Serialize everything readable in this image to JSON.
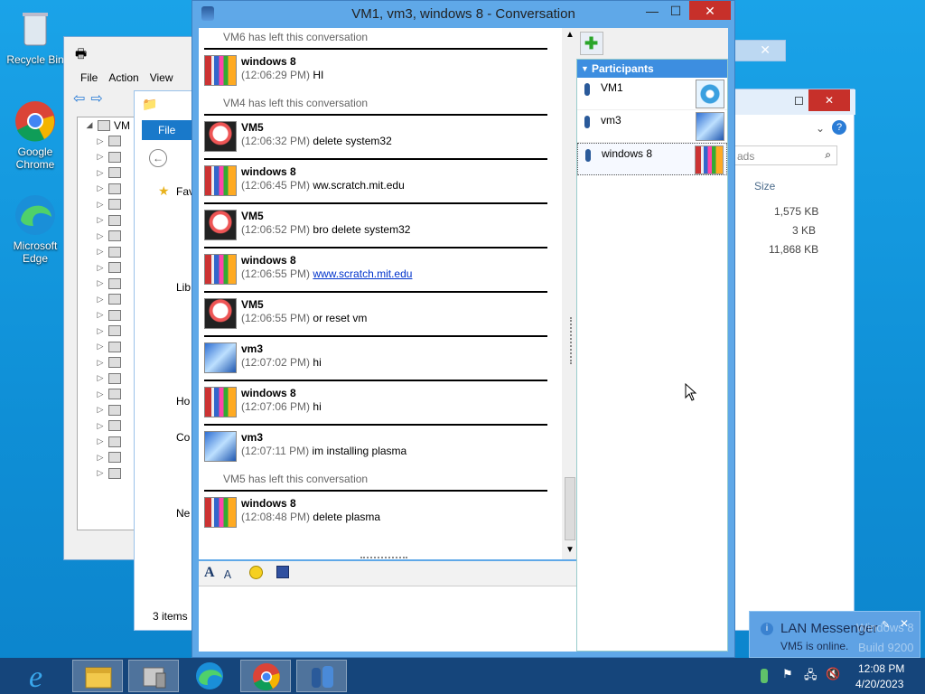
{
  "desktop": {
    "icons": [
      {
        "label": "Recycle Bin",
        "icon": "recycle-bin-icon"
      },
      {
        "label": "Google\nChrome",
        "icon": "chrome-icon"
      },
      {
        "label": "Microsoft\nEdge",
        "icon": "edge-icon"
      }
    ]
  },
  "mmc": {
    "menu": [
      "File",
      "Action",
      "View"
    ],
    "tree_top": "VM"
  },
  "explorer": {
    "file_tab": "File",
    "favorites": "Fav",
    "libraries": "Lib",
    "homegroup": "Ho",
    "computer": "Co",
    "network": "Ne",
    "status": "3 items",
    "search_placeholder": "ads",
    "size_header": "Size",
    "sizes": [
      "1,575 KB",
      "3 KB",
      "11,868 KB"
    ]
  },
  "conversation": {
    "title": "VM1, vm3, windows 8 - Conversation",
    "minimize": "—",
    "maximize": "☐",
    "close": "✕",
    "items": [
      {
        "kind": "sys",
        "text": "VM6 has left this conversation"
      },
      {
        "kind": "msg",
        "name": "windows 8",
        "time": "(12:06:29 PM)",
        "text": "HI",
        "avatar": "w"
      },
      {
        "kind": "sys",
        "text": "VM4 has left this conversation"
      },
      {
        "kind": "msg",
        "name": "VM5",
        "time": "(12:06:32 PM)",
        "text": "delete system32",
        "avatar": "v"
      },
      {
        "kind": "msg",
        "name": "windows 8",
        "time": "(12:06:45 PM)",
        "text": "ww.scratch.mit.edu",
        "avatar": "w"
      },
      {
        "kind": "msg",
        "name": "VM5",
        "time": "(12:06:52 PM)",
        "text": "bro delete system32",
        "avatar": "v"
      },
      {
        "kind": "msg",
        "name": "windows 8",
        "time": "(12:06:55 PM)",
        "text": "www.scratch.mit.edu",
        "avatar": "w",
        "link": true
      },
      {
        "kind": "msg",
        "name": "VM5",
        "time": "(12:06:55 PM)",
        "text": "or reset vm",
        "avatar": "v"
      },
      {
        "kind": "msg",
        "name": "vm3",
        "time": "(12:07:02 PM)",
        "text": "hi",
        "avatar": "3"
      },
      {
        "kind": "msg",
        "name": "windows 8",
        "time": "(12:07:06 PM)",
        "text": "hi",
        "avatar": "w"
      },
      {
        "kind": "msg",
        "name": "vm3",
        "time": "(12:07:11 PM)",
        "text": "im installing plasma",
        "avatar": "3"
      },
      {
        "kind": "sys",
        "text": "VM5 has left this conversation"
      },
      {
        "kind": "msg",
        "name": "windows 8",
        "time": "(12:08:48 PM)",
        "text": "delete plasma",
        "avatar": "w"
      }
    ],
    "participants_header": "Participants",
    "participants": [
      {
        "name": "VM1",
        "avatar": "ferris"
      },
      {
        "name": "vm3",
        "avatar": "3"
      },
      {
        "name": "windows 8",
        "avatar": "w"
      }
    ]
  },
  "notification": {
    "title": "LAN Messenger",
    "text": "VM5 is online.",
    "watermark1": "Windows 8",
    "watermark2": "Build 9200"
  },
  "clock": {
    "time": "12:08 PM",
    "date": "4/20/2023"
  },
  "colors": {
    "accent": "#3d8ee0",
    "close": "#c7302a",
    "taskbar": "#15457b"
  }
}
